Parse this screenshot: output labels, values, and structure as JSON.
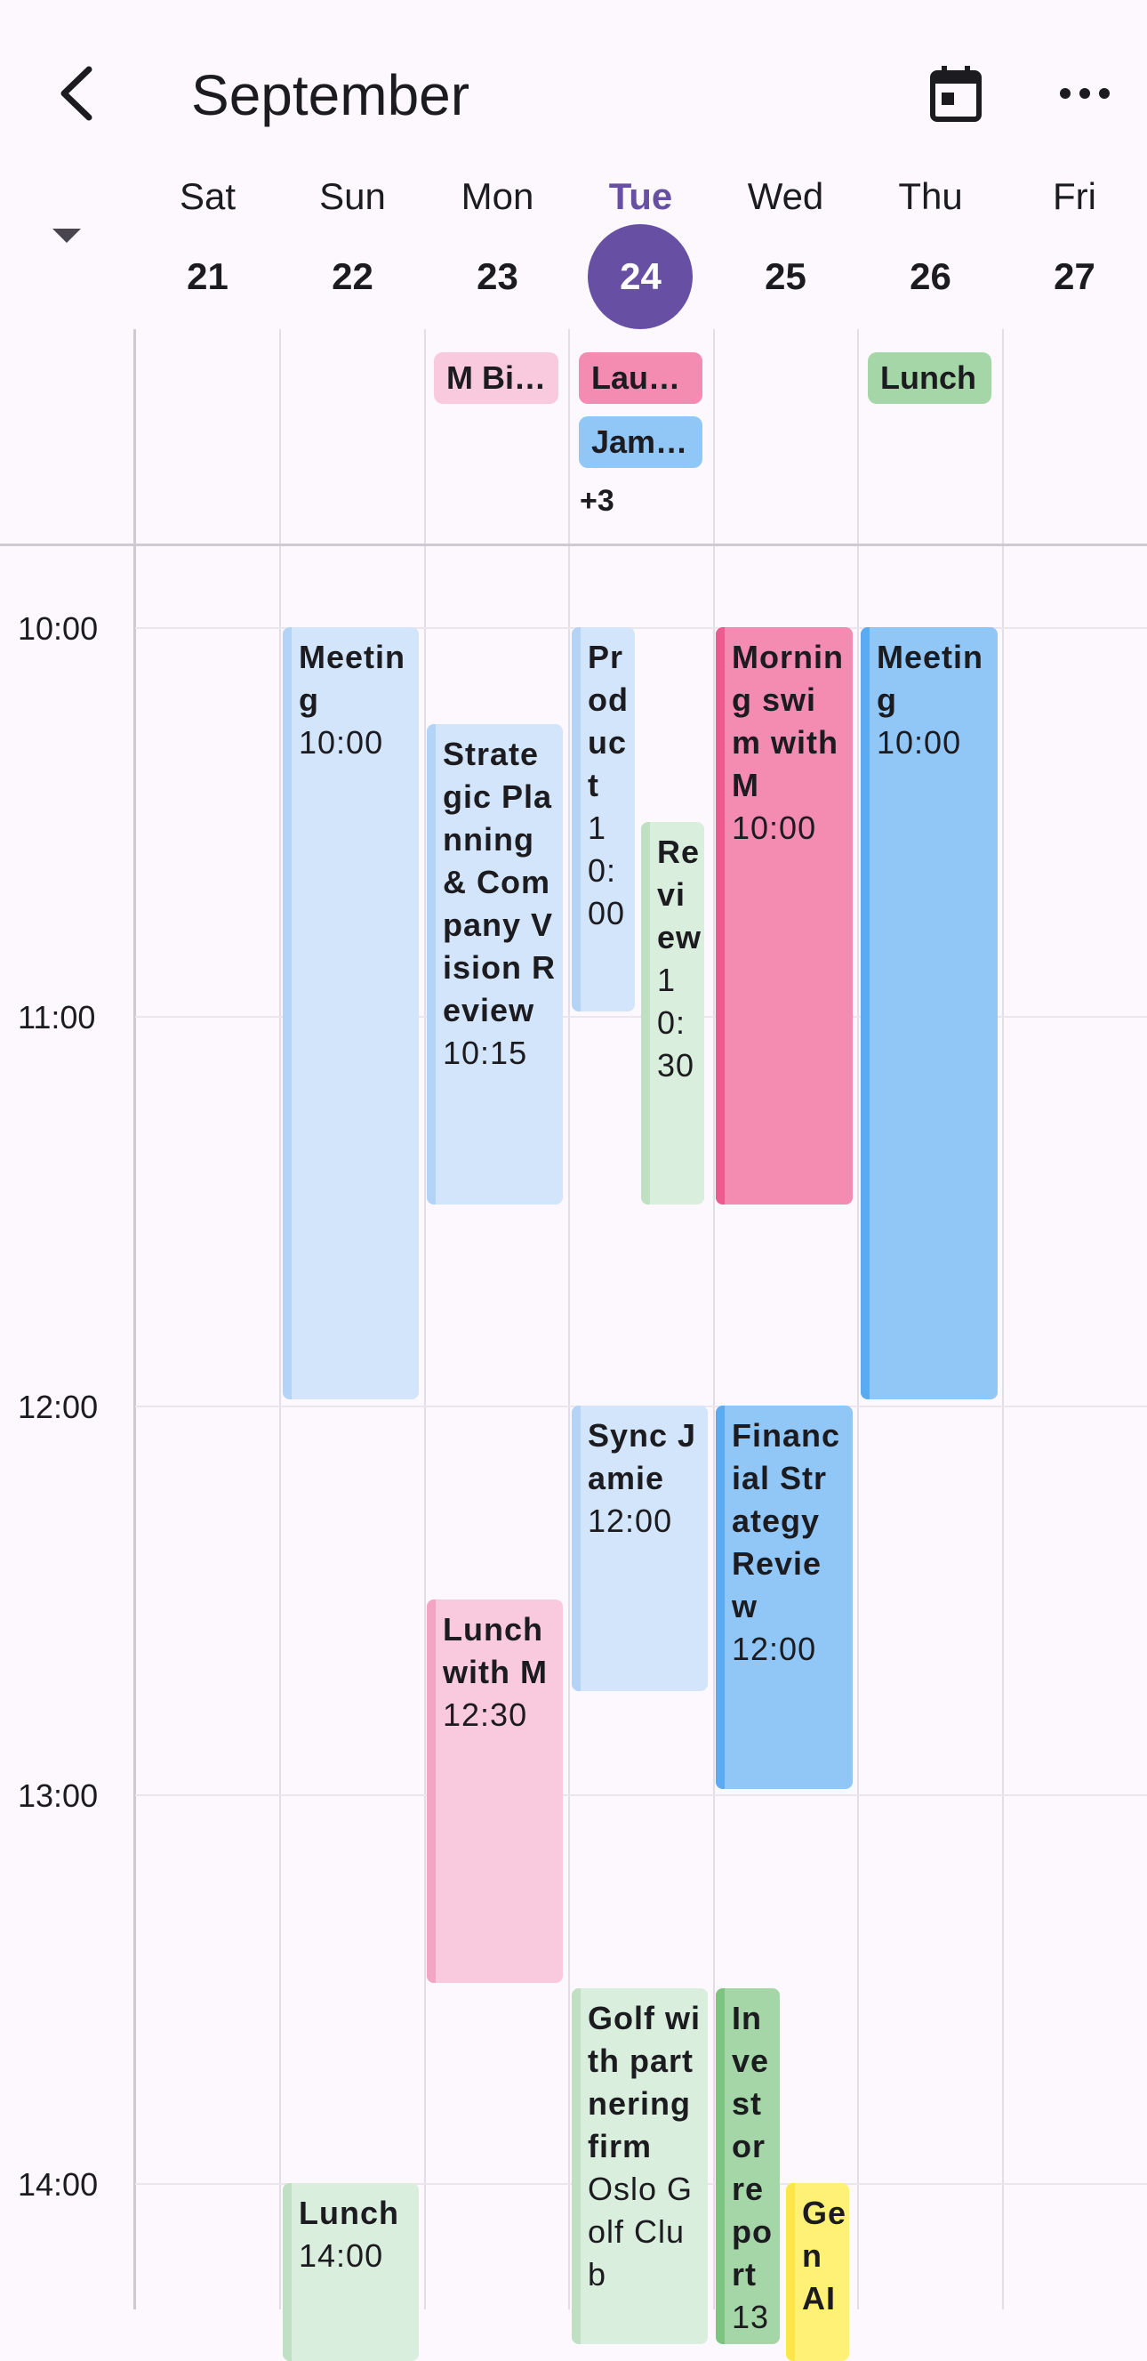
{
  "header": {
    "title": "September",
    "back_icon": "chevron-left-icon",
    "calendar_icon": "calendar-today-icon",
    "more_icon": "more-horizontal-icon",
    "collapse_icon": "caret-down-icon"
  },
  "days": [
    {
      "name": "Sat",
      "num": "21"
    },
    {
      "name": "Sun",
      "num": "22"
    },
    {
      "name": "Mon",
      "num": "23"
    },
    {
      "name": "Tue",
      "num": "24"
    },
    {
      "name": "Wed",
      "num": "25"
    },
    {
      "name": "Thu",
      "num": "26"
    },
    {
      "name": "Fri",
      "num": "27"
    }
  ],
  "today_color": "#6750a4",
  "all_day": {
    "mon": "M Bi…",
    "tue_1": "Lau…",
    "tue_2": "Jami…",
    "tue_more": "+3",
    "thu": "Lunch"
  },
  "time_labels": [
    "10:00",
    "11:00",
    "12:00",
    "13:00",
    "14:00"
  ],
  "events": {
    "sun_meeting": {
      "title": "Meeting",
      "time": "10:00"
    },
    "mon_strategic": {
      "title": "Strategic Planning & Company Vision Review",
      "time": "10:15"
    },
    "tue_product": {
      "title": "Product",
      "time": "10:00"
    },
    "tue_review": {
      "title": "Review",
      "time": "10:30"
    },
    "wed_swim": {
      "title": "Morning swim with M",
      "time": "10:00"
    },
    "thu_meeting": {
      "title": "Meeting",
      "time": "10:00"
    },
    "tue_sync": {
      "title": "Sync Jamie",
      "time": "12:00"
    },
    "wed_financial": {
      "title": "Financial Strategy Review",
      "time": "12:00"
    },
    "mon_lunch": {
      "title": "Lunch with M",
      "time": "12:30"
    },
    "tue_golf": {
      "title": "Golf with partnering firm",
      "location": "Oslo Golf Club"
    },
    "wed_investor": {
      "title": "Investor report",
      "time": "13"
    },
    "wed_genai": {
      "title": "Gen AI"
    },
    "sun_lunch": {
      "title": "Lunch",
      "time": "14:00"
    }
  }
}
